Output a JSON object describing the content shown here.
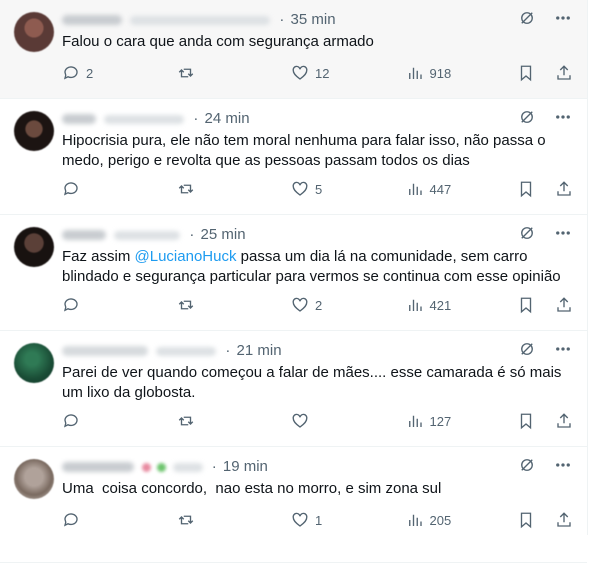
{
  "tweets": [
    {
      "time": "35 min",
      "text": "Falou o cara que anda com segurança armado",
      "mention": "",
      "text_after": "",
      "replies": "2",
      "retweets": "",
      "likes": "12",
      "views": "918",
      "avatar_color": "#5a3a36"
    },
    {
      "time": "24 min",
      "text": "Hipocrisia pura, ele não tem moral nenhuma para falar isso, não passa o medo, perigo e revolta que as pessoas passam todos os dias",
      "mention": "",
      "text_after": "",
      "replies": "",
      "retweets": "",
      "likes": "5",
      "views": "447",
      "avatar_color": "#3b2a24"
    },
    {
      "time": "25 min",
      "text": "Faz assim ",
      "mention": "@LucianoHuck",
      "text_after": " passa um dia lá na comunidade, sem carro blindado e segurança particular para vermos se continua com esse opinião",
      "replies": "",
      "retweets": "",
      "likes": "2",
      "views": "421",
      "avatar_color": "#2c1f1b"
    },
    {
      "time": "21 min",
      "text": "Parei de ver quando começou a falar de mães.... esse camarada é só mais um lixo da globosta.",
      "mention": "",
      "text_after": "",
      "replies": "",
      "retweets": "",
      "likes": "",
      "views": "127",
      "avatar_color": "#1f5a3e"
    },
    {
      "time": "19 min",
      "text": "Uma  coisa concordo,  nao esta no morro, e sim zona sul",
      "mention": "",
      "text_after": "",
      "replies": "",
      "retweets": "",
      "likes": "1",
      "views": "205",
      "avatar_color": "#8a7a70"
    }
  ],
  "icons": {
    "reply": "reply-icon",
    "retweet": "retweet-icon",
    "like": "heart-icon",
    "views": "views-icon",
    "bookmark": "bookmark-icon",
    "share": "share-icon",
    "grok": "grok-icon",
    "more": "more-icon"
  },
  "colors": {
    "accent": "#1d9bf0",
    "muted": "#536471",
    "text": "#0f1419"
  }
}
